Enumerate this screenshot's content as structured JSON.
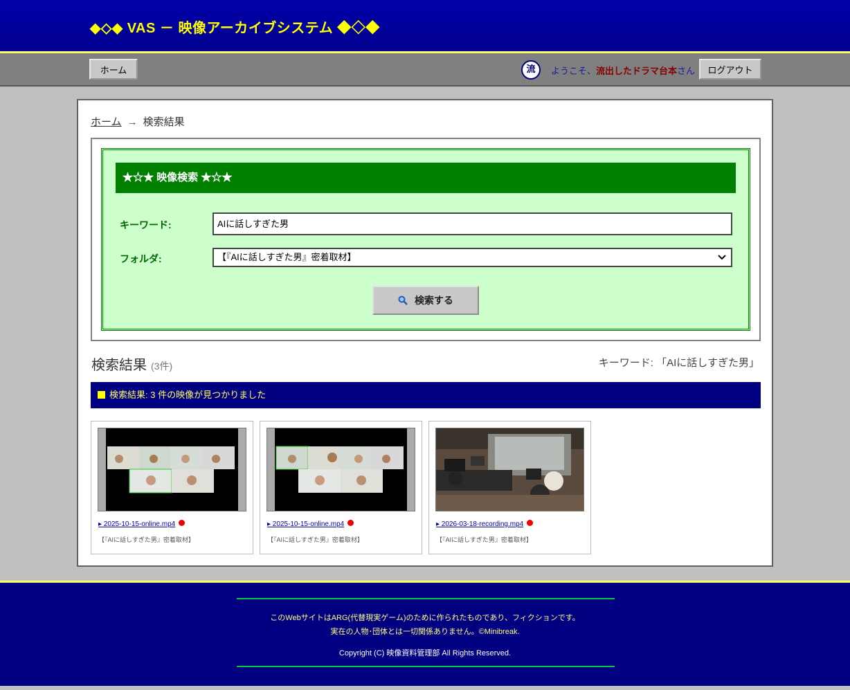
{
  "site": {
    "title": "◆◇◆ VAS － 映像アーカイブシステム ◆◇◆"
  },
  "nav": {
    "home_label": "ホーム",
    "avatar_char": "流",
    "welcome_prefix": "ようこそ、",
    "user_name": "流出したドラマ台本",
    "welcome_suffix": "さん",
    "logout_label": "ログアウト"
  },
  "breadcrumb": {
    "home": "ホーム",
    "arrow": "→",
    "current": "検索結果"
  },
  "search": {
    "heading": "★☆★ 映像検索 ★☆★",
    "keyword_label": "キーワード:",
    "keyword_value": "AIに話しすぎた男",
    "folder_label": "フォルダ:",
    "folder_value": "【『AIに話しすぎた男』密着取材】",
    "button_label": "検索する"
  },
  "results": {
    "title": "検索結果",
    "count": "(3件)",
    "keyword_summary": "キーワード: 「AIに話しすぎた男」",
    "bar_text": "検索結果: 3 件の映像が見つかりました",
    "items": [
      {
        "file": "▸ 2025-10-15-online.mp4",
        "folder": "【『AIに話しすぎた男』密着取材】",
        "thumb": "online-meeting"
      },
      {
        "file": "▸ 2025-10-15-online.mp4",
        "folder": "【『AIに話しすぎた男』密着取材】",
        "thumb": "online-meeting"
      },
      {
        "file": "▸ 2026-03-18-recording.mp4",
        "folder": "【『AIに話しすぎた男』密着取材】",
        "thumb": "recording-studio"
      }
    ]
  },
  "footer": {
    "line1": "このWebサイトはARG(代替現実ゲーム)のために作られたものであり、フィクションです。",
    "line2": "実在の人物･団体とは一切関係ありません。©Minibreak.",
    "copyright": "Copyright (C) 映像資料管理部 All Rights Reserved."
  },
  "colors": {
    "header_bg": "#000090",
    "accent_yellow": "#ffff00",
    "search_green": "#008000",
    "search_panel": "#ccffcc",
    "result_bar": "#000080",
    "user_name": "#880000"
  }
}
